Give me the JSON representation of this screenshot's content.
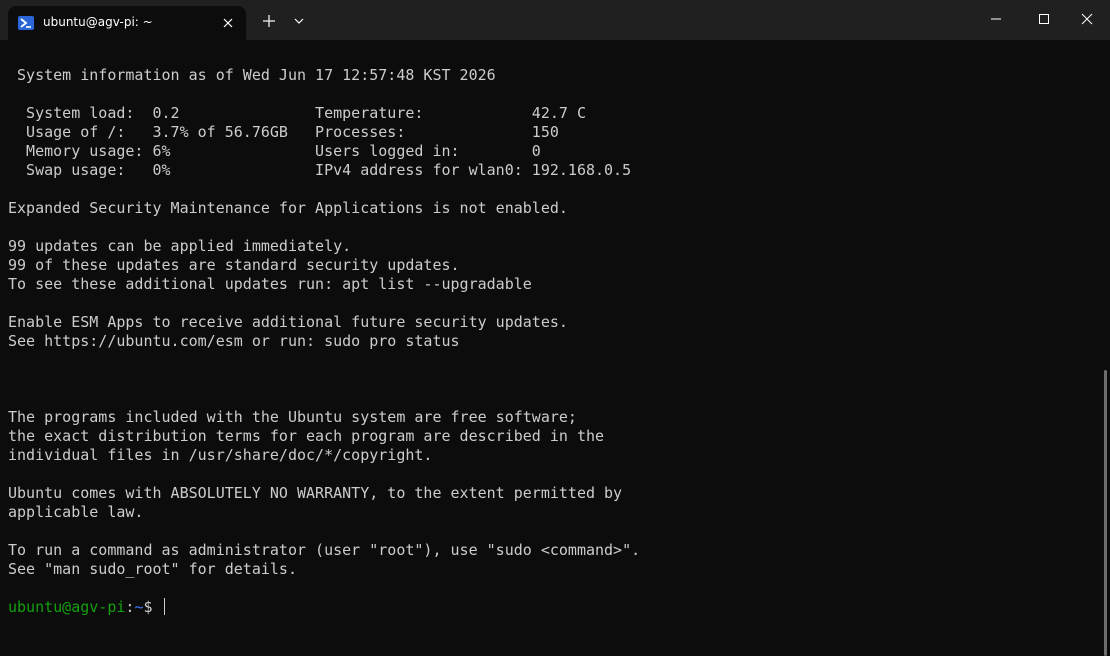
{
  "window": {
    "tab_title": "ubuntu@agv-pi: ~",
    "tab_icon": "powershell-icon",
    "new_tab_icon": "plus-icon",
    "dropdown_icon": "chevron-down-icon"
  },
  "terminal": {
    "lines": [
      " System information as of Wed Jun 17 12:57:48 KST 2026",
      "",
      "  System load:  0.2               Temperature:            42.7 C",
      "  Usage of /:   3.7% of 56.76GB   Processes:              150",
      "  Memory usage: 6%                Users logged in:        0",
      "  Swap usage:   0%                IPv4 address for wlan0: 192.168.0.5",
      "",
      "Expanded Security Maintenance for Applications is not enabled.",
      "",
      "99 updates can be applied immediately.",
      "99 of these updates are standard security updates.",
      "To see these additional updates run: apt list --upgradable",
      "",
      "Enable ESM Apps to receive additional future security updates.",
      "See https://ubuntu.com/esm or run: sudo pro status",
      "",
      "",
      "",
      "The programs included with the Ubuntu system are free software;",
      "the exact distribution terms for each program are described in the",
      "individual files in /usr/share/doc/*/copyright.",
      "",
      "Ubuntu comes with ABSOLUTELY NO WARRANTY, to the extent permitted by",
      "applicable law.",
      "",
      "To run a command as administrator (user \"root\"), use \"sudo <command>\".",
      "See \"man sudo_root\" for details.",
      ""
    ],
    "prompt": {
      "user_host": "ubuntu@agv-pi",
      "colon": ":",
      "path": "~",
      "symbol": "$ "
    }
  },
  "colors": {
    "background": "#0c0c0c",
    "text": "#cccccc",
    "prompt_user": "#13a10e",
    "prompt_path": "#3b78ff",
    "titlebar": "#202020"
  }
}
